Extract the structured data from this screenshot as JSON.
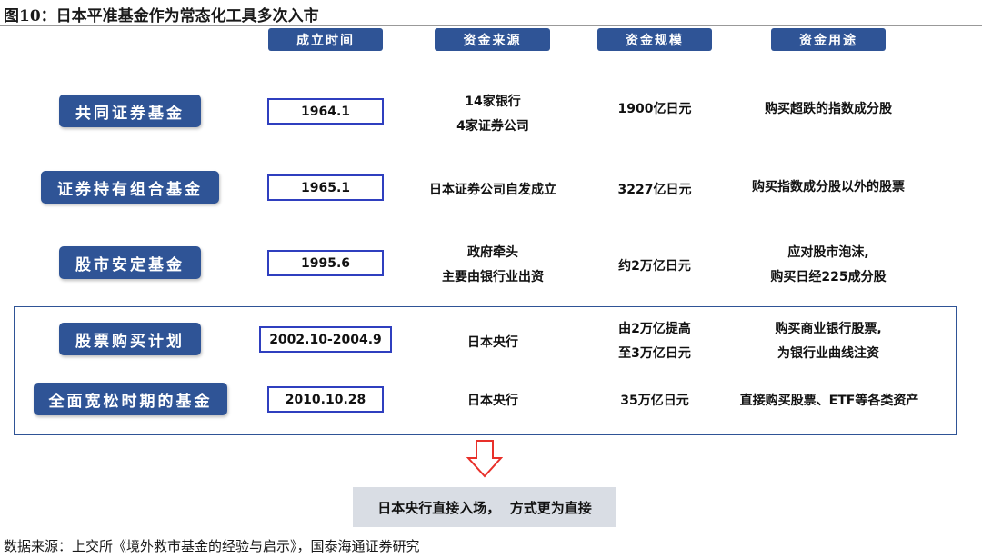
{
  "figure": {
    "title": "图10：日本平准基金作为常态化工具多次入市",
    "source": "数据来源：上交所《境外救市基金的经验与启示》，国泰海通证券研究"
  },
  "headers": {
    "date": "成立时间",
    "funding_source": "资金来源",
    "scale": "资金规模",
    "usage": "资金用途"
  },
  "rows": [
    {
      "name": "共同证券基金",
      "date": "1964.1",
      "source": [
        "14家银行",
        "4家证券公司"
      ],
      "scale": [
        "1900亿日元"
      ],
      "usage": [
        "购买超跌的指数成分股"
      ]
    },
    {
      "name": "证券持有组合基金",
      "date": "1965.1",
      "source": [
        "日本证券公司自发成立"
      ],
      "scale": [
        "3227亿日元"
      ],
      "usage": [
        "购买指数成分股以外的股票"
      ]
    },
    {
      "name": "股市安定基金",
      "date": "1995.6",
      "source": [
        "政府牵头",
        "主要由银行业出资"
      ],
      "scale": [
        "约2万亿日元"
      ],
      "usage": [
        "应对股市泡沫,",
        "购买日经225成分股"
      ]
    },
    {
      "name": "股票购买计划",
      "date": "2002.10-2004.9",
      "source": [
        "日本央行"
      ],
      "scale": [
        "由2万亿提高",
        "至3万亿日元"
      ],
      "usage": [
        "购买商业银行股票,",
        "为银行业曲线注资"
      ]
    },
    {
      "name": "全面宽松时期的基金",
      "date": "2010.10.28",
      "source": [
        "日本央行"
      ],
      "scale": [
        "35万亿日元"
      ],
      "usage": [
        "直接购买股票、ETF等各类资产"
      ]
    }
  ],
  "conclusion": "日本央行直接入场，  方式更为直接",
  "colors": {
    "pill": "#2f5496",
    "date_border": "#2f3fbf",
    "arrow": "#e8302a",
    "conclusion_bg": "#d9dde4"
  },
  "icons": {
    "arrow": "down-arrow-icon"
  }
}
